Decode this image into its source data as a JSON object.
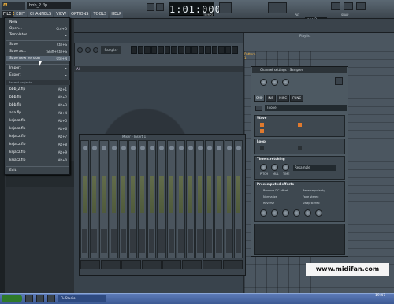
{
  "app": {
    "logo": "FL STUDIO",
    "filename": "bbb_2.flp",
    "time": "1:01:000",
    "tempo_label": "TEMPO",
    "pattern_label": "PAT",
    "pattern_select": "Inner2",
    "snap_label": "SNAP",
    "accent": "#f2b23b"
  },
  "menubar": [
    "FILE",
    "EDIT",
    "CHANNELS",
    "VIEW",
    "OPTIONS",
    "TOOLS",
    "HELP"
  ],
  "file_menu": {
    "items": [
      {
        "label": "New",
        "shortcut": ""
      },
      {
        "label": "Open...",
        "shortcut": "Ctrl+O"
      },
      {
        "label": "Templates",
        "shortcut": ""
      },
      {
        "label": "Save",
        "shortcut": "Ctrl+S"
      },
      {
        "label": "Save as...",
        "shortcut": "Shift+Ctrl+S"
      },
      {
        "label": "Save new version",
        "shortcut": "Ctrl+N"
      },
      {
        "label": "Import",
        "shortcut": ""
      },
      {
        "label": "Export",
        "shortcut": ""
      }
    ],
    "recent_header": "Recent projects",
    "recent": [
      {
        "label": "bbb_2.flp",
        "shortcut": "Alt+1"
      },
      {
        "label": "bbb.flp",
        "shortcut": "Alt+2"
      },
      {
        "label": "bbb.flp",
        "shortcut": "Alt+3"
      },
      {
        "label": "aaa.flp",
        "shortcut": "Alt+4"
      },
      {
        "label": "ksjacz.flp",
        "shortcut": "Alt+5"
      },
      {
        "label": "ksjacz.flp",
        "shortcut": "Alt+6"
      },
      {
        "label": "ksjacz.flp",
        "shortcut": "Alt+7"
      },
      {
        "label": "ksjacz.flp",
        "shortcut": "Alt+8"
      },
      {
        "label": "ksjacz.flp",
        "shortcut": "Alt+9"
      },
      {
        "label": "ksjacz.flp",
        "shortcut": "Alt+0"
      }
    ],
    "exit": "Exit"
  },
  "step_seq": {
    "channel": "Sampler",
    "all_label": "All"
  },
  "playlist": {
    "title": "Playlist",
    "patterns": [
      "Pattern 1",
      "Pattern 2",
      "Pattern 3",
      "Pattern 4",
      "Pattern 5",
      "Pattern 6",
      "Pattern 7",
      "Pattern 8",
      "Pattern 9",
      "Pattern 10"
    ]
  },
  "mixer": {
    "title": "Mixer - Insert 1",
    "strip_label": "Insert 1"
  },
  "channel_settings": {
    "title": "Channel settings - Sampler",
    "tabs": [
      "SMP",
      "INS",
      "MISC",
      "FUNC"
    ],
    "sample": "(none)",
    "wave_label": "Wave",
    "loop_label": "Loop",
    "time_label": "Time stretching",
    "time_mode": "Resample",
    "knob_labels": [
      "PITCH",
      "MUL",
      "TIME"
    ],
    "precomp_label": "Precomputed effects",
    "effects": [
      "Remove DC offset",
      "Normalize",
      "Reverse",
      "Reverse polarity",
      "Fade stereo",
      "Swap stereo"
    ],
    "effect_knobs": [
      "IN",
      "OUT",
      "ATT",
      "DEC",
      "SUS",
      "REL"
    ]
  },
  "left_rows": [
    "Insert",
    "Insert"
  ],
  "watermark": "www.midifan.com",
  "taskbar": {
    "item": "FL Studio",
    "clock": "19:47"
  }
}
